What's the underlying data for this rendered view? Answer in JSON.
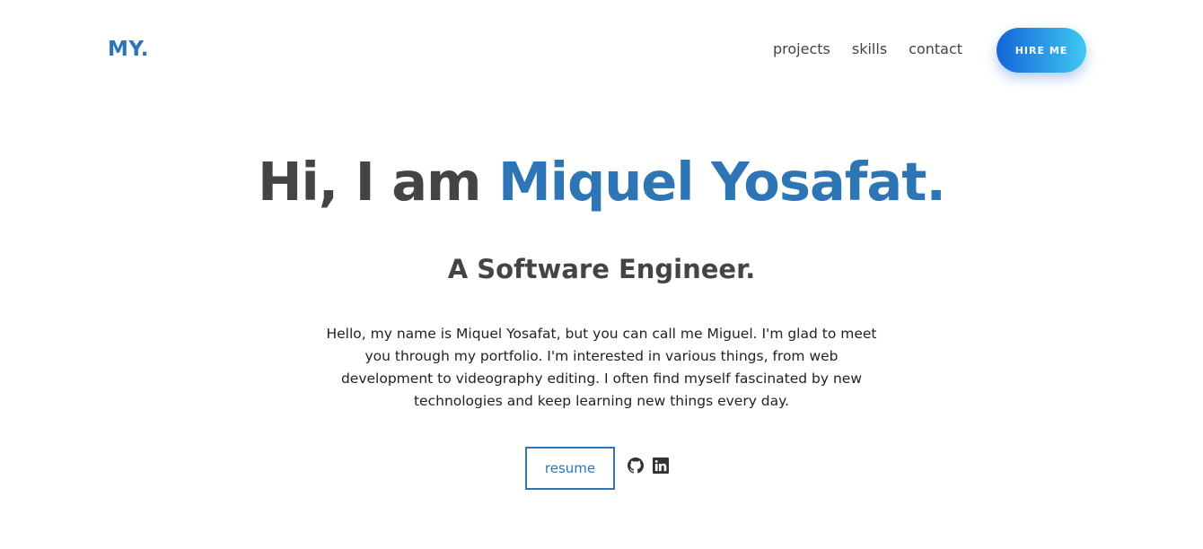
{
  "nav": {
    "logo": "MY.",
    "links": [
      "projects",
      "skills",
      "contact"
    ],
    "hire_label": "HIRE ME"
  },
  "hero": {
    "greeting": "Hi, I am ",
    "name": "Miquel Yosafat.",
    "subtitle": "A Software Engineer.",
    "bio": "Hello, my name is Miquel Yosafat, but you can call me Miguel. I'm glad to meet you through my portfolio. I'm interested in various things, from web development to videography editing. I often find myself fascinated by new technologies and keep learning new things every day.",
    "resume_label": "resume",
    "social_icons": [
      "github-icon",
      "linkedin-icon"
    ]
  },
  "colors": {
    "accent": "#2e75b6",
    "text": "#444444",
    "button_gradient_start": "#1565d8",
    "button_gradient_end": "#3fc8f2"
  }
}
